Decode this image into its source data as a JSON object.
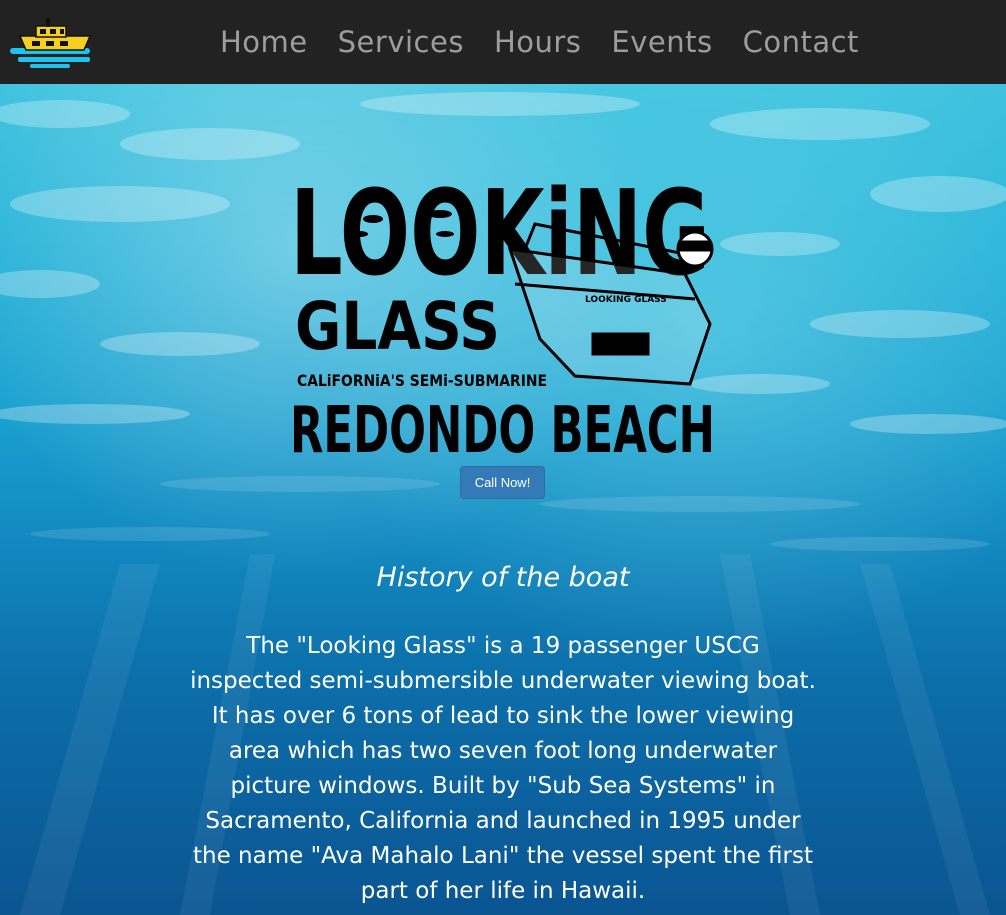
{
  "nav": {
    "links": [
      "Home",
      "Services",
      "Hours",
      "Events",
      "Contact"
    ]
  },
  "hero": {
    "logo_text": {
      "line1": "LOOKiNG",
      "line2": "GLASS",
      "line3": "CALiFORNiA'S SEMi-SUBMARINE",
      "line4": "REDONDO BEACH",
      "boat_label": "LOOKING GLASS"
    },
    "call_button_label": "Call Now!"
  },
  "history": {
    "title": "History of the boat",
    "body": "The \"Looking Glass\" is a 19 passenger USCG inspected semi-submersible underwater viewing boat. It has over 6 tons of lead to sink the lower viewing area which has two seven foot long underwater picture windows. Built by \"Sub Sea Systems\" in Sacramento, California and launched in 1995 under the name \"Ava Mahalo Lani\" the vessel spent the first part of her life in Hawaii."
  },
  "colors": {
    "navbar_bg": "#222222",
    "nav_link": "#9d9d9d",
    "button_bg": "#337ab7",
    "ocean_top": "#3fc3df",
    "ocean_bottom": "#0a5592"
  }
}
